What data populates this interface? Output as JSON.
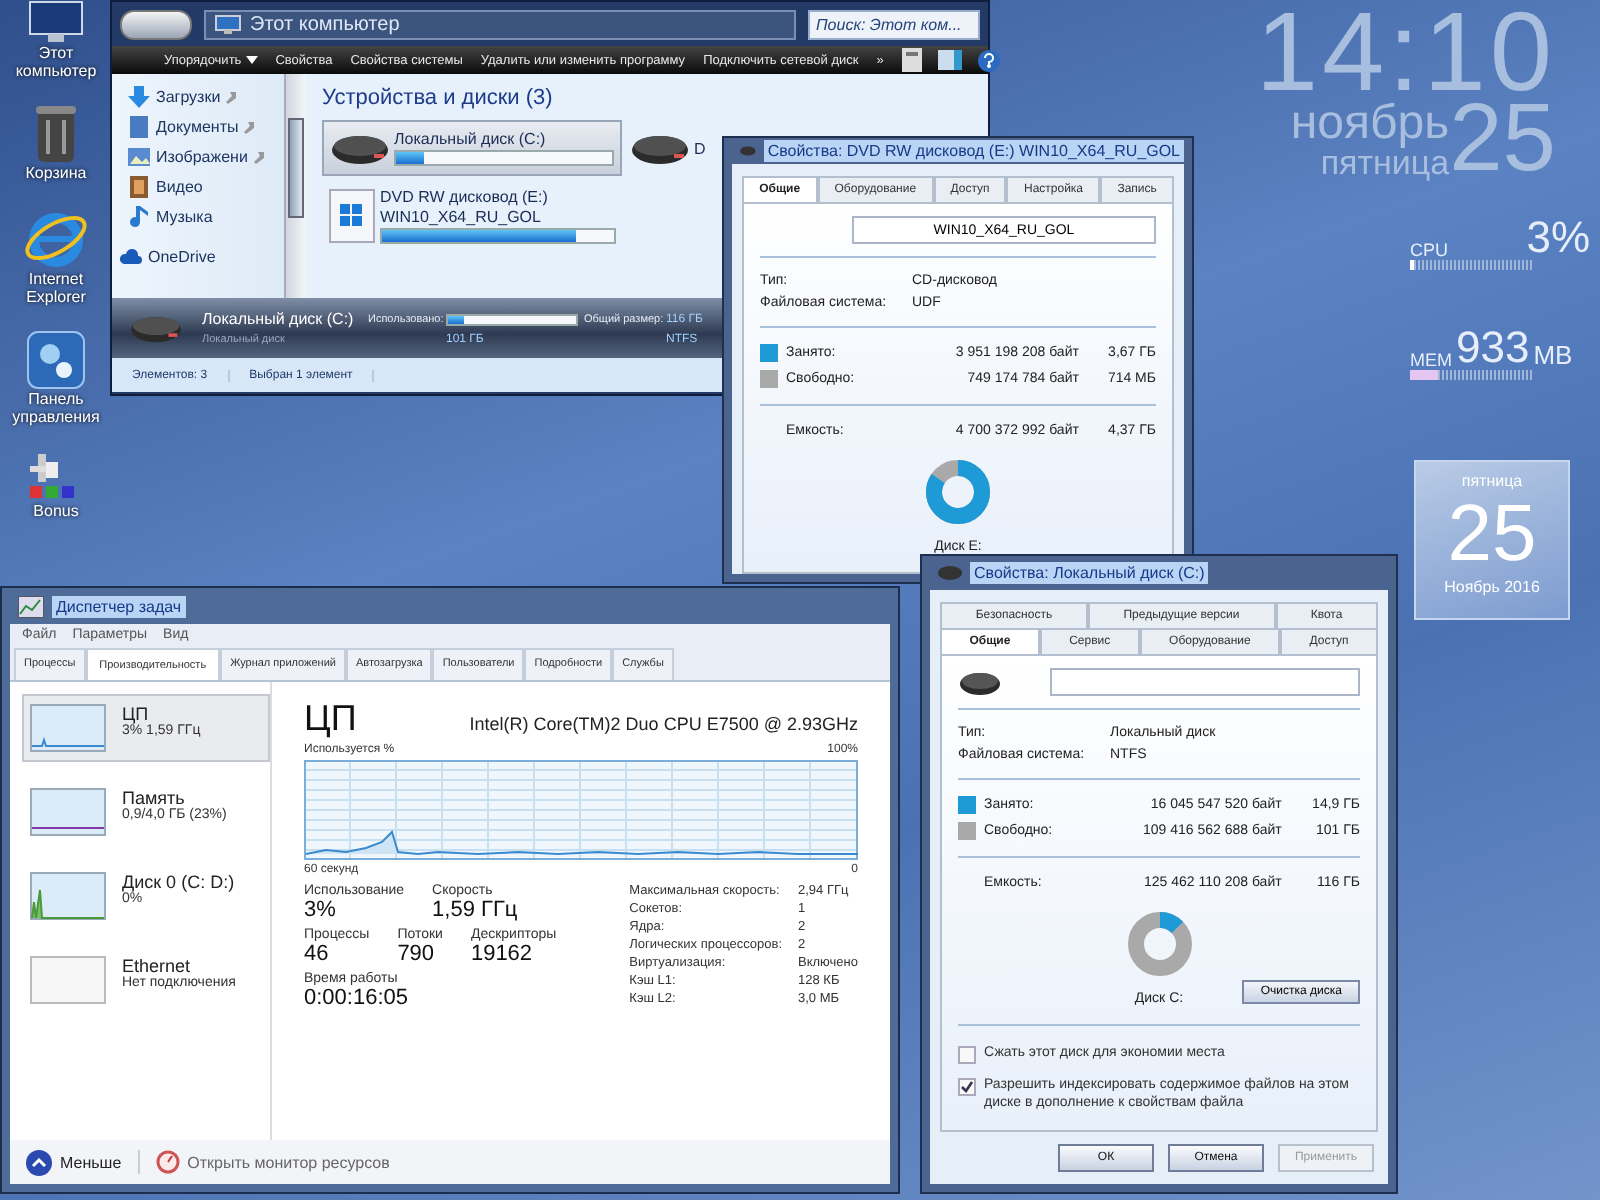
{
  "desktop_icons": [
    {
      "label": "Этот компьютер",
      "kind": "computer"
    },
    {
      "label": "Корзина",
      "kind": "bin"
    },
    {
      "label": "Internet Explorer",
      "kind": "ie"
    },
    {
      "label": "Панель управления",
      "kind": "panel"
    },
    {
      "label": "Bonus",
      "kind": "bonus"
    }
  ],
  "explorer": {
    "address": "Этот компьютер",
    "search": {
      "placeholder": "Поиск: Этот ком..."
    },
    "toolbar": [
      {
        "label": "Упорядочить",
        "dropdown": true
      },
      {
        "label": "Свойства",
        "dropdown": false
      },
      {
        "label": "Свойства системы",
        "dropdown": false
      },
      {
        "label": "Удалить или изменить программу",
        "dropdown": false
      },
      {
        "label": "Подключить сетевой диск",
        "dropdown": false
      },
      {
        "label": "»",
        "dropdown": false
      }
    ],
    "nav": [
      {
        "label": "Загрузки",
        "kind": "download",
        "pinned": true
      },
      {
        "label": "Документы",
        "kind": "documents",
        "pinned": true
      },
      {
        "label": "Изображени",
        "kind": "pictures",
        "pinned": true
      },
      {
        "label": "Видео",
        "kind": "video",
        "pinned": false
      },
      {
        "label": "Музыка",
        "kind": "music",
        "pinned": false
      },
      {
        "label": "OneDrive",
        "kind": "cloud",
        "pinned": false
      }
    ],
    "group": "Устройства и диски (3)",
    "drives": [
      {
        "name": "Локальный диск (C:)",
        "kind": "hdd",
        "selected": true,
        "level": 0.13
      },
      {
        "name": "D",
        "kind": "hdd",
        "selected": false
      },
      {
        "name": "DVD RW дисковод (E:)",
        "label": "WIN10_X64_RU_GOL",
        "kind": "dvd",
        "selected": false,
        "level": 0.84
      }
    ],
    "details": {
      "name": "Локальный диск (C:)",
      "used_label": "Использовано:",
      "level": 0.13,
      "total_label": "Общий размер:",
      "total": "116 ГБ",
      "type": "Локальный диск",
      "free": "101 ГБ",
      "fs": "NTFS"
    },
    "status": [
      "Элементов: 3",
      "Выбран 1 элемент"
    ]
  },
  "property_windows": [
    {
      "title": "Свойства: DVD RW дисковод (E:) WIN10_X64_RU_GOL",
      "tab_rows": [
        [
          {
            "label": "Общие",
            "selected": true
          },
          {
            "label": "Оборудование",
            "selected": false
          },
          {
            "label": "Доступ",
            "selected": false
          },
          {
            "label": "Настройка",
            "selected": false
          },
          {
            "label": "Запись",
            "selected": false
          }
        ]
      ],
      "label_value": "WIN10_X64_RU_GOL",
      "info": [
        {
          "label": "Тип:",
          "value": "CD-дисковод"
        },
        {
          "label": "Файловая система:",
          "value": "UDF"
        }
      ],
      "usage": [
        {
          "label": "Занято:",
          "bytes": "3 951 198 208 байт",
          "size": "3,67 ГБ",
          "color": "#1e9ad6"
        },
        {
          "label": "Свободно:",
          "bytes": "749 174 784 байт",
          "size": "714 МБ",
          "color": "#a9a9a9"
        }
      ],
      "capacity": {
        "label": "Емкость:",
        "bytes": "4 700 372 992 байт",
        "size": "4,37 ГБ"
      },
      "level": 0.84,
      "disk_label": "Диск E:"
    },
    {
      "title": "Свойства: Локальный диск (C:)",
      "kind": "hdd",
      "tab_rows": [
        [
          {
            "label": "Безопасность",
            "selected": false
          },
          {
            "label": "Предыдущие версии",
            "selected": false
          },
          {
            "label": "Квота",
            "selected": false
          }
        ],
        [
          {
            "label": "Общие",
            "selected": true
          },
          {
            "label": "Сервис",
            "selected": false
          },
          {
            "label": "Оборудование",
            "selected": false
          },
          {
            "label": "Доступ",
            "selected": false
          }
        ]
      ],
      "info": [
        {
          "label": "Тип:",
          "value": "Локальный диск"
        },
        {
          "label": "Файловая система:",
          "value": "NTFS"
        }
      ],
      "usage": [
        {
          "label": "Занято:",
          "bytes": "16 045 547 520 байт",
          "size": "14,9 ГБ",
          "color": "#1e9ad6"
        },
        {
          "label": "Свободно:",
          "bytes": "109 416 562 688 байт",
          "size": "101 ГБ",
          "color": "#a9a9a9"
        }
      ],
      "capacity": {
        "label": "Емкость:",
        "bytes": "125 462 110 208 байт",
        "size": "116 ГБ"
      },
      "level": 0.128,
      "disk_label": "Диск C:",
      "cleanup_button": "Очистка диска",
      "checkboxes": [
        {
          "label": "Сжать этот диск для экономии места",
          "checked": false
        },
        {
          "label": "Разрешить индексировать содержимое файлов на этом диске в дополнение к свойствам файла",
          "checked": true
        }
      ],
      "buttons": [
        {
          "label": "ОК",
          "disabled": false
        },
        {
          "label": "Отмена",
          "disabled": false
        },
        {
          "label": "Применить",
          "disabled": true
        }
      ]
    }
  ],
  "task_manager": {
    "title": "Диспетчер задач",
    "menu": [
      "Файл",
      "Параметры",
      "Вид"
    ],
    "tabs": [
      {
        "label": "Процессы",
        "selected": false
      },
      {
        "label": "Производительность",
        "selected": true
      },
      {
        "label": "Журнал приложений",
        "selected": false
      },
      {
        "label": "Автозагрузка",
        "selected": false
      },
      {
        "label": "Пользователи",
        "selected": false
      },
      {
        "label": "Подробности",
        "selected": false
      },
      {
        "label": "Службы",
        "selected": false
      }
    ],
    "resources": [
      {
        "name": "ЦП",
        "detail": "3% 1,59 ГГц",
        "kind": "cpu",
        "selected": true
      },
      {
        "name": "Память",
        "detail": "0,9/4,0 ГБ (23%)",
        "kind": "memory",
        "selected": false
      },
      {
        "name": "Диск 0 (C: D:)",
        "detail": "0%",
        "kind": "disk",
        "selected": false
      },
      {
        "name": "Ethernet",
        "detail": "Нет подключения",
        "kind": "network",
        "selected": false
      }
    ],
    "heading": "ЦП",
    "cpu_model": "Intel(R) Core(TM)2 Duo CPU E7500 @ 2.93GHz",
    "graph_label": "Используется %",
    "graph_max": "100%",
    "graph_span": "60 секунд",
    "graph_min": "0",
    "stats_rows": [
      [
        {
          "label": "Использование",
          "value": "3%"
        },
        {
          "label": "Скорость",
          "value": "1,59 ГГц"
        }
      ],
      [
        {
          "label": "Процессы",
          "value": "46"
        },
        {
          "label": "Потоки",
          "value": "790"
        },
        {
          "label": "Дескрипторы",
          "value": "19162"
        }
      ],
      [
        {
          "label": "Время работы",
          "value": "0:00:16:05"
        }
      ]
    ],
    "specs": [
      {
        "label": "Максимальная скорость:",
        "value": "2,94 ГГц"
      },
      {
        "label": "Сокетов:",
        "value": "1"
      },
      {
        "label": "Ядра:",
        "value": "2"
      },
      {
        "label": "Логических процессоров:",
        "value": "2"
      },
      {
        "label": "Виртуализация:",
        "value": "Включено"
      },
      {
        "label": "Кэш L1:",
        "value": "128 КБ"
      },
      {
        "label": "Кэш L2:",
        "value": "3,0 МБ"
      }
    ],
    "footer": {
      "less": "Меньше",
      "monitor_link": "Открыть монитор ресурсов"
    }
  },
  "clock": {
    "time": "14:10",
    "month": "ноябрь",
    "weekday": "пятница",
    "day": "25"
  },
  "cpu_meter": {
    "label": "CPU",
    "value": "3%",
    "level": 0.03
  },
  "mem_meter": {
    "label": "MEM",
    "value": "933",
    "unit": "MB",
    "level": 0.23
  },
  "calendar": {
    "weekday": "пятница",
    "day": "25",
    "month_year": "Ноябрь 2016"
  }
}
